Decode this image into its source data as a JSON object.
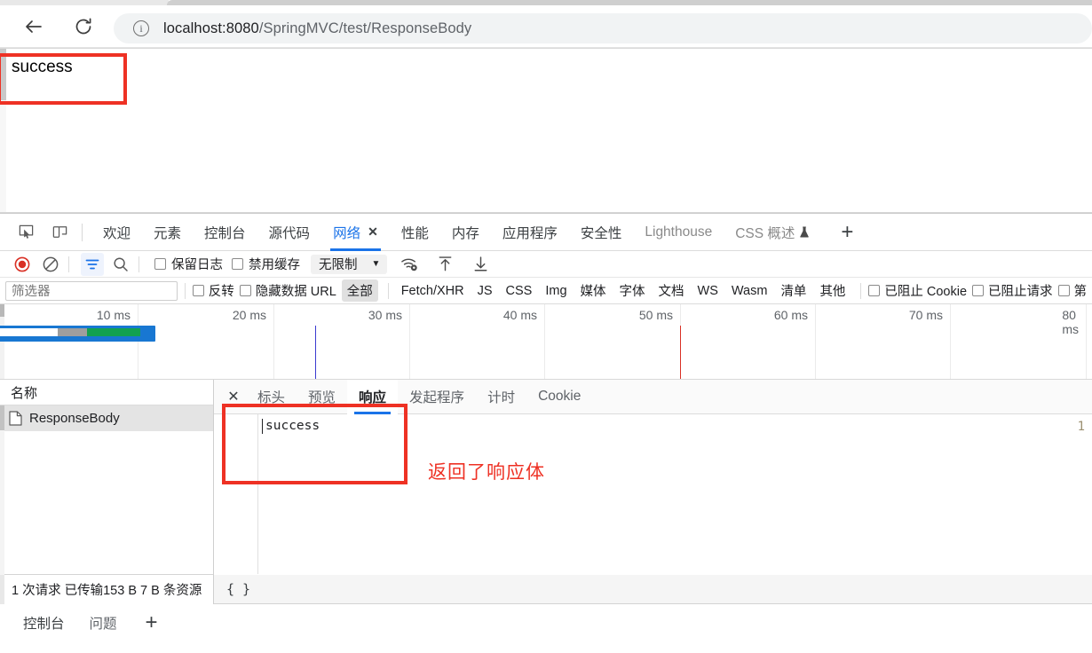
{
  "browser": {
    "back_label": "back-arrow",
    "reload_label": "reload",
    "url_host": "localhost:8080",
    "url_path": "/SpringMVC/test/ResponseBody",
    "site_info_icon": "info-icon"
  },
  "page": {
    "body_text": "success"
  },
  "annotations": {
    "success_box": "",
    "response_box": "",
    "response_note": "返回了响应体",
    "color": "#ee3124"
  },
  "devtools": {
    "panel_tabs": [
      {
        "label": "欢迎",
        "state": "normal"
      },
      {
        "label": "元素",
        "state": "normal"
      },
      {
        "label": "控制台",
        "state": "normal"
      },
      {
        "label": "源代码",
        "state": "normal"
      },
      {
        "label": "网络",
        "state": "active",
        "closable": true,
        "close_label": "✕"
      },
      {
        "label": "性能",
        "state": "normal"
      },
      {
        "label": "内存",
        "state": "normal"
      },
      {
        "label": "应用程序",
        "state": "normal"
      },
      {
        "label": "安全性",
        "state": "normal"
      },
      {
        "label": "Lighthouse",
        "state": "dim"
      },
      {
        "label": "CSS 概述",
        "state": "dim",
        "badge": "flask-icon"
      }
    ],
    "add_tab_label": "+",
    "toolbar": {
      "record_icon": "record-stop-icon",
      "clear_icon": "clear-icon",
      "filter_icon": "filter-icon",
      "search_icon": "search-icon",
      "preserve_log": {
        "label": "保留日志",
        "checked": false
      },
      "disable_cache": {
        "label": "禁用缓存",
        "checked": false
      },
      "throttle": {
        "value": "无限制",
        "caret": "▼"
      },
      "network_conditions_icon": "wifi-gear-icon",
      "import_icon": "upload-arrow-icon",
      "export_icon": "download-arrow-icon"
    },
    "filterbar": {
      "filter_placeholder": "筛选器",
      "invert": {
        "label": "反转",
        "checked": false
      },
      "hide_data_urls": {
        "label": "隐藏数据 URL",
        "checked": false
      },
      "types": [
        "全部",
        "Fetch/XHR",
        "JS",
        "CSS",
        "Img",
        "媒体",
        "字体",
        "文档",
        "WS",
        "Wasm",
        "清单",
        "其他"
      ],
      "selected_type": "全部",
      "blocked_cookies": {
        "label": "已阻止 Cookie",
        "checked": false
      },
      "blocked_requests": {
        "label": "已阻止请求",
        "checked": false
      },
      "third_party": {
        "label": "第",
        "checked": false
      }
    },
    "overview": {
      "ticks": [
        "10 ms",
        "20 ms",
        "30 ms",
        "40 ms",
        "50 ms",
        "60 ms",
        "70 ms",
        "80 ms"
      ],
      "dom_content_loaded_color": "#3a3ad0",
      "load_event_color": "#d93025",
      "request_bar": {
        "outline_color": "#1877d2",
        "segments": [
          {
            "name": "queueing",
            "color": "#ffffff"
          },
          {
            "name": "stalled",
            "color": "#9e9e9e"
          },
          {
            "name": "waiting",
            "color": "#12a150"
          },
          {
            "name": "download",
            "color": "#1877d2"
          }
        ]
      }
    },
    "requests": {
      "column_header": "名称",
      "rows": [
        {
          "name": "ResponseBody",
          "icon": "document-icon",
          "selected": true
        }
      ]
    },
    "detail": {
      "close_label": "✕",
      "tabs": [
        "标头",
        "预览",
        "响应",
        "发起程序",
        "计时",
        "Cookie"
      ],
      "active_tab": "响应",
      "response": {
        "line_number": "1",
        "content": "success"
      }
    },
    "status": {
      "summary": "1 次请求  已传输153 B  7 B 条资源",
      "pretty_print": "{ }"
    },
    "drawer": {
      "tabs": [
        "控制台",
        "问题"
      ],
      "add_label": "+"
    }
  }
}
